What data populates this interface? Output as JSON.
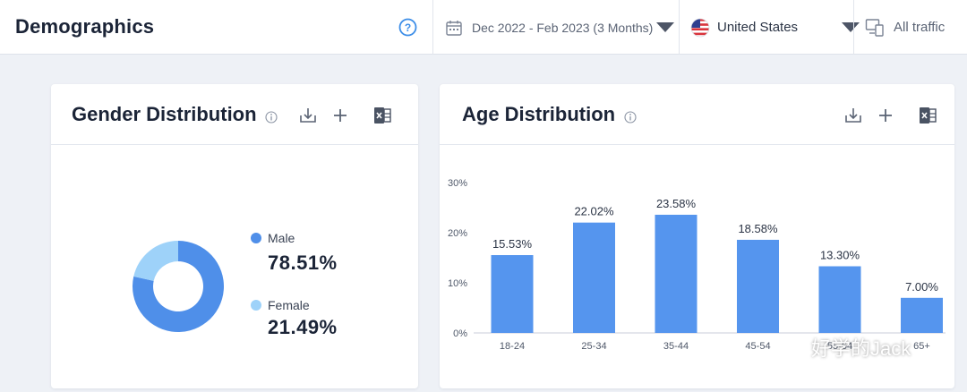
{
  "header": {
    "title": "Demographics",
    "date_range": "Dec 2022 - Feb 2023 (3 Months)",
    "country": "United States",
    "traffic": "All traffic"
  },
  "gender": {
    "title": "Gender Distribution",
    "segments": [
      {
        "label": "Male",
        "value": "78.51%",
        "fraction": 0.7851,
        "color": "#4f8fe9"
      },
      {
        "label": "Female",
        "value": "21.49%",
        "fraction": 0.2149,
        "color": "#9ed2f9"
      }
    ]
  },
  "chart_data": {
    "type": "bar",
    "title": "Age Distribution",
    "categories": [
      "18-24",
      "25-34",
      "35-44",
      "45-54",
      "55-64",
      "65+"
    ],
    "values": [
      15.53,
      22.02,
      23.58,
      18.58,
      13.3,
      7.0
    ],
    "value_labels": [
      "15.53%",
      "22.02%",
      "23.58%",
      "18.58%",
      "13.30%",
      "7.00%"
    ],
    "y_ticks": [
      "0%",
      "10%",
      "20%",
      "30%"
    ],
    "ylim": [
      0,
      30
    ],
    "grid": false,
    "bar_color": "#5595ee"
  },
  "watermark": {
    "text": "好学的Jack"
  }
}
